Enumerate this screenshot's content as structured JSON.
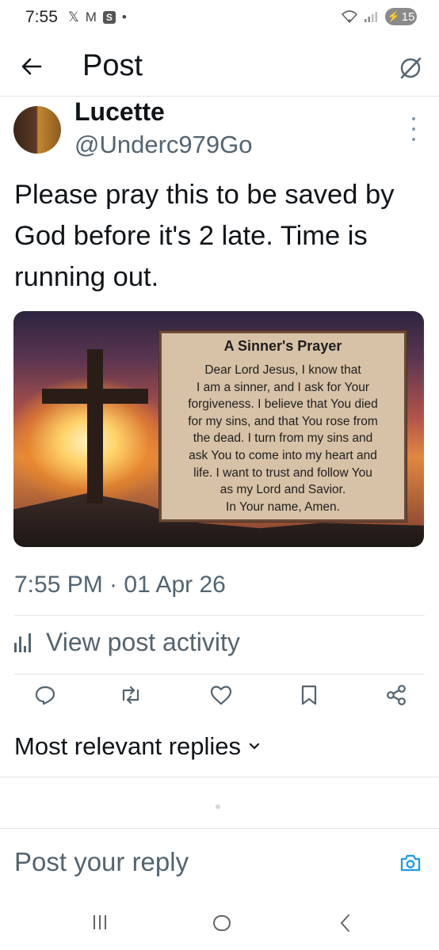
{
  "status_bar": {
    "time": "7:55",
    "notification_icons": [
      "x-logo-icon",
      "gmail-icon",
      "s-app-icon",
      "dot-icon"
    ],
    "x_glyph": "𝕏",
    "m_glyph": "M",
    "s_glyph": "S",
    "dot_glyph": "•",
    "battery": "15"
  },
  "header": {
    "title": "Post"
  },
  "post": {
    "author_name": "Lucette",
    "author_handle": "@Underc979Go",
    "text": "Please pray this to be saved by God before it's 2 late. Time is running out.",
    "image": {
      "card_title": "A Sinner's Prayer",
      "card_lines": [
        "Dear Lord Jesus, I know that",
        "I am a sinner, and I ask for Your",
        "forgiveness. I believe that You died",
        "for my sins, and that You rose from",
        "the dead. I turn from my sins and",
        "ask You to come into my heart and",
        "life. I want to trust and follow You",
        "as my Lord and Savior.",
        "In Your name, Amen."
      ]
    },
    "timestamp": "7:55 PM · 01 Apr 26",
    "activity_label": "View post activity"
  },
  "actions": [
    "reply-icon",
    "repost-icon",
    "like-icon",
    "bookmark-icon",
    "share-icon"
  ],
  "replies": {
    "heading": "Most relevant replies",
    "chevron": "⌄"
  },
  "composer": {
    "placeholder": "Post your reply"
  },
  "colors": {
    "accent": "#1d9bf0",
    "secondary_text": "#536471",
    "primary_text": "#0f1419"
  }
}
